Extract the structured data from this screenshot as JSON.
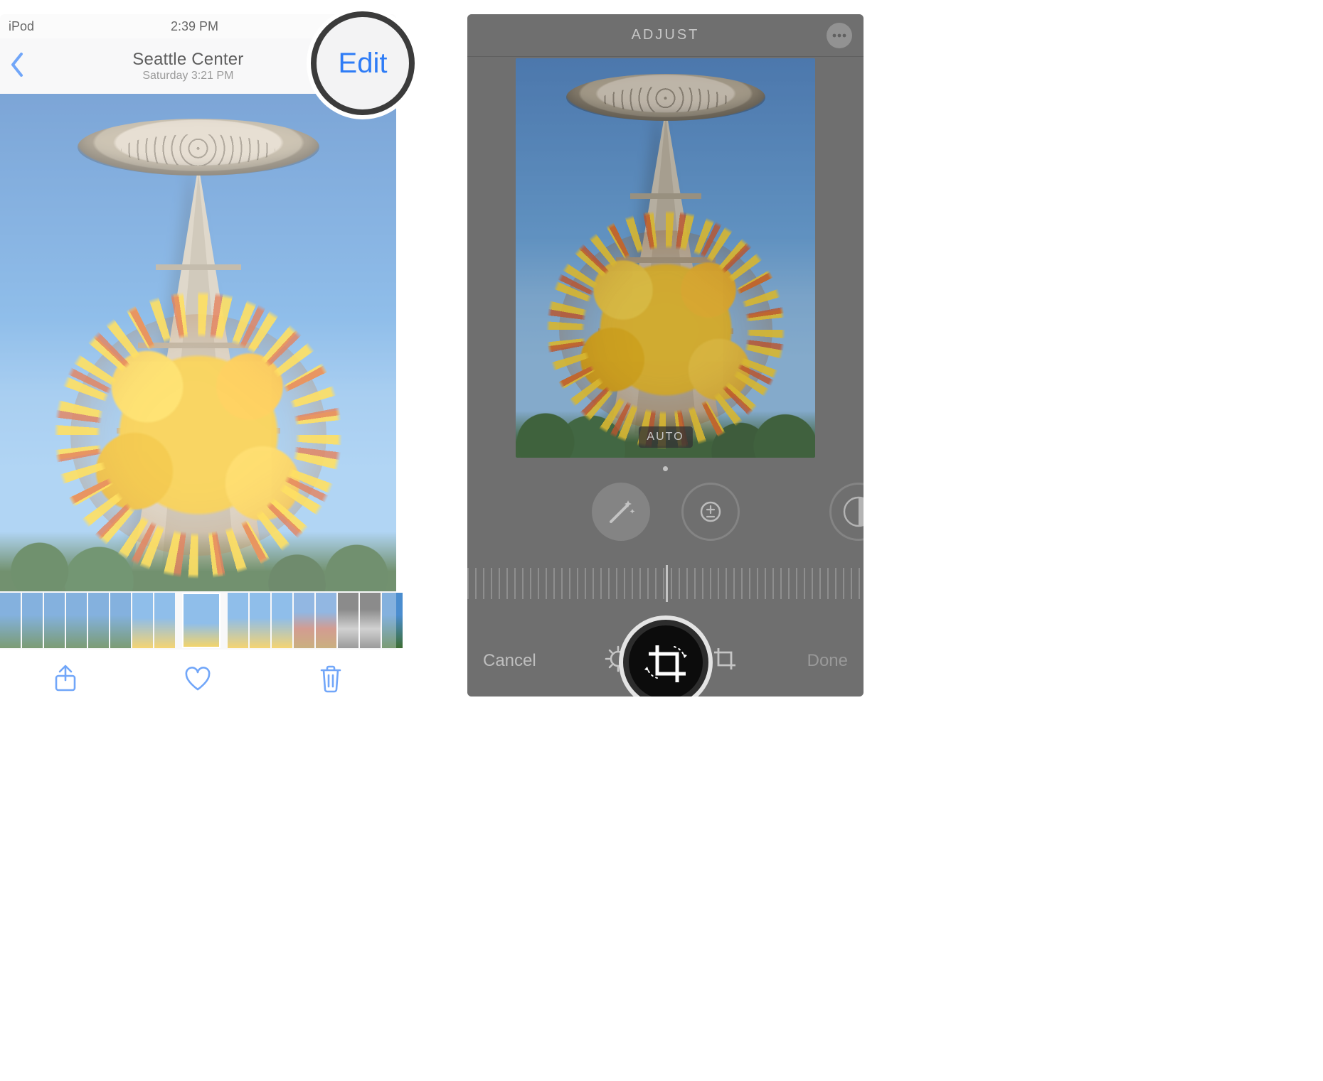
{
  "left": {
    "status": {
      "device": "iPod",
      "time": "2:39 PM"
    },
    "nav": {
      "title": "Seattle Center",
      "subtitle": "Saturday  3:21 PM",
      "edit_label": "Edit"
    }
  },
  "right": {
    "header": {
      "title": "ADJUST"
    },
    "auto_label": "AUTO",
    "bottom": {
      "cancel_label": "Cancel",
      "done_label": "Done"
    }
  },
  "colors": {
    "ios_blue": "#2e7cf6",
    "edit_bg_gray": "#6f6f6f",
    "accent_yellow": "#f5bb2a"
  }
}
